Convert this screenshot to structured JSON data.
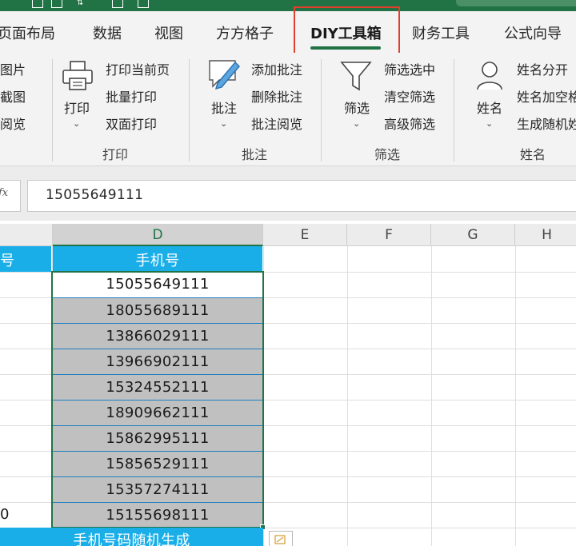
{
  "tabs": [
    "页面布局",
    "数据",
    "视图",
    "方方格子",
    "DIY工具箱",
    "财务工具",
    "公式向导"
  ],
  "active_tab": "DIY工具箱",
  "ribbon": {
    "left_partial": [
      "图片",
      "截图",
      "阅览"
    ],
    "print": {
      "big_label": "打印",
      "items": [
        "打印当前页",
        "批量打印",
        "双面打印"
      ],
      "group": "打印"
    },
    "comment": {
      "big_label": "批注",
      "items": [
        "添加批注",
        "删除批注",
        "批注阅览"
      ],
      "group": "批注"
    },
    "filter": {
      "big_label": "筛选",
      "items": [
        "筛选选中",
        "清空筛选",
        "高级筛选"
      ],
      "group": "筛选"
    },
    "name": {
      "big_label": "姓名",
      "items": [
        "姓名分开",
        "姓名加空格",
        "生成随机姓"
      ],
      "group": "姓名"
    }
  },
  "formula_bar": {
    "fx": "fx",
    "value": "15055649111"
  },
  "columns": [
    "D",
    "E",
    "F",
    "G",
    "H"
  ],
  "col_c_header_partial": "号",
  "col_d_header": "手机号",
  "phones": [
    "15055649111",
    "18055689111",
    "13866029111",
    "13966902111",
    "15324552111",
    "18909662111",
    "15862995111",
    "15856529111",
    "15357274111",
    "15155698111"
  ],
  "partial_left_value": "0",
  "footer_banner": "手机号码随机生成"
}
